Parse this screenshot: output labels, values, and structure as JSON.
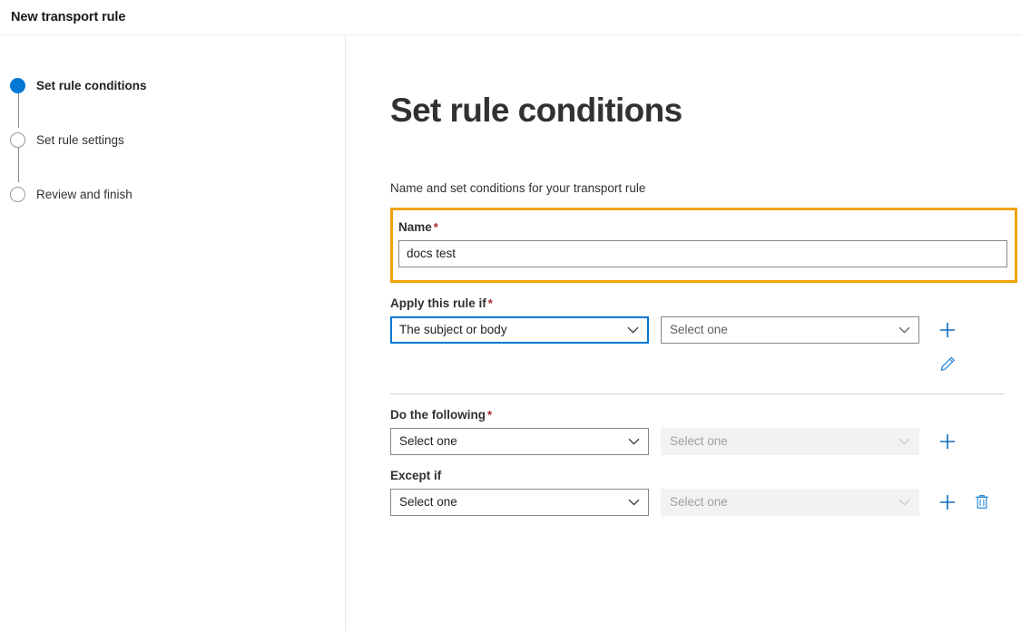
{
  "window": {
    "title": "New transport rule"
  },
  "colors": {
    "accent_blue": "#0078d4",
    "icon_blue": "#0f6cbd",
    "highlight_orange": "#f0a30a",
    "required_red": "#a4262c",
    "disabled_bg": "#f3f2f1"
  },
  "stepper": {
    "steps": [
      {
        "label": "Set rule conditions",
        "state": "active"
      },
      {
        "label": "Set rule settings",
        "state": "pending"
      },
      {
        "label": "Review and finish",
        "state": "pending"
      }
    ]
  },
  "main": {
    "title": "Set rule conditions",
    "subtitle": "Name and set conditions for your transport rule",
    "name_field": {
      "label": "Name",
      "required_marker": "*",
      "value": "docs test",
      "placeholder": ""
    },
    "apply_if": {
      "label": "Apply this rule if",
      "required_marker": "*",
      "condition_value": "The subject or body",
      "operand_value": "Select one",
      "add_label": "+",
      "edit_label": "edit"
    },
    "do_following": {
      "label": "Do the following",
      "required_marker": "*",
      "action_value": "Select one",
      "operand_value": "Select one",
      "add_label": "+"
    },
    "except_if": {
      "label": "Except if",
      "required_marker": "",
      "condition_value": "Select one",
      "operand_value": "Select one",
      "add_label": "+",
      "delete_label": "delete"
    }
  }
}
